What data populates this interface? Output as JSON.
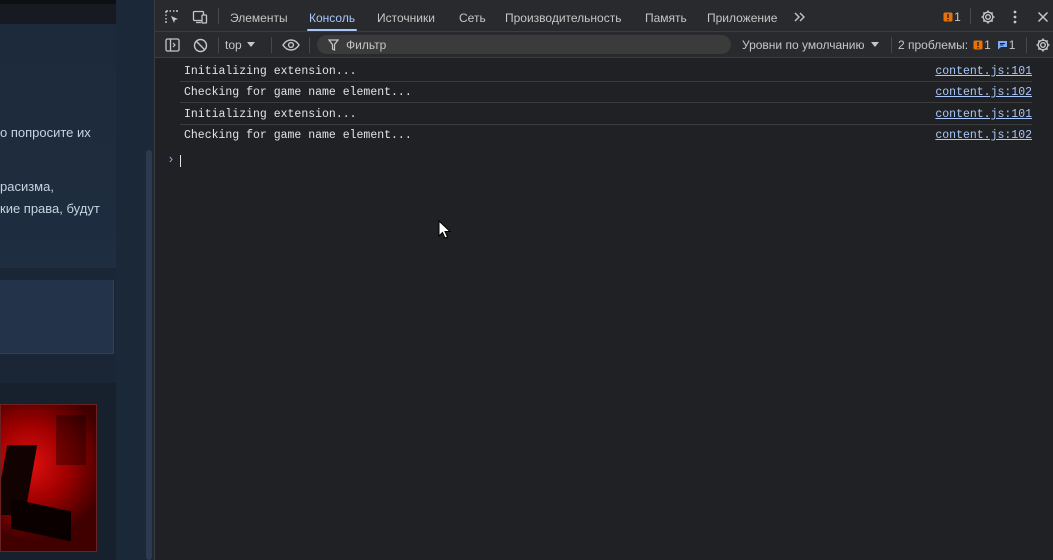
{
  "page": {
    "text_lines": [
      "о попросите их",
      "расизма,",
      "кие права, будут"
    ]
  },
  "devtools": {
    "tabs": [
      {
        "label": "Элементы"
      },
      {
        "label": "Консоль",
        "active": true
      },
      {
        "label": "Источники"
      },
      {
        "label": "Сеть"
      },
      {
        "label": "Производительность"
      },
      {
        "label": "Память"
      },
      {
        "label": "Приложение"
      }
    ],
    "issues_badge": "1",
    "toolbar": {
      "context": "top",
      "filter_placeholder": "Фильтр",
      "levels": "Уровни по умолчанию",
      "problems_label": "2 проблемы:",
      "warn_count": "1",
      "info_count": "1"
    },
    "console": {
      "messages": [
        {
          "text": "Initializing extension...",
          "source": "content.js:101"
        },
        {
          "text": "Checking for game name element...",
          "source": "content.js:102"
        },
        {
          "text": "Initializing extension...",
          "source": "content.js:101"
        },
        {
          "text": "Checking for game name element...",
          "source": "content.js:102"
        }
      ],
      "prompt": "›"
    },
    "colors": {
      "accent": "#a8c7fa",
      "warn": "#e8710a",
      "info": "#7cacf8",
      "background": "#202124"
    },
    "icons": [
      "inspect-icon",
      "device-toolbar-icon",
      "more-tabs-icon",
      "settings-icon",
      "kebab-menu-icon",
      "close-icon",
      "sidebar-icon",
      "clear-console-icon",
      "eye-icon",
      "filter-icon",
      "console-settings-icon"
    ]
  }
}
